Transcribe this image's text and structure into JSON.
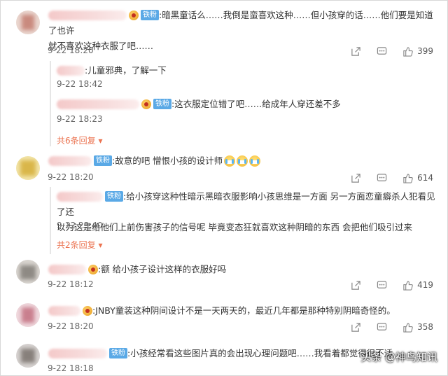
{
  "comments": [
    {
      "badge": "铁粉",
      "text": ":暗黑童话么……我倒是蛮喜欢这种……但小孩穿的话……他们要是知道了也许",
      "text2": "就不喜欢这种衣服了吧……",
      "time": "9-22 18:20",
      "likes": "399",
      "replies": [
        {
          "text": ":儿童邪典，了解一下",
          "time": "9-22 18:42"
        },
        {
          "badge": "铁粉",
          "text": ":这衣服定位错了吧……给成年人穿还差不多",
          "time": "9-22 18:23"
        }
      ],
      "more": "共6条回复 ▾"
    },
    {
      "badge": "铁粉",
      "text": ":故意的吧 憎恨小孩的设计师",
      "time": "9-22 18:20",
      "likes": "614",
      "replies": [
        {
          "badge": "铁粉",
          "text": ":给小孩穿这种性暗示黑暗衣服影响小孩思维是一方面 另一方面恋童癖杀人犯看见了还",
          "text2": "以为这是给他们上前伤害孩子的信号呢 毕竟变态狂就喜欢这种阴暗的东西 会把他们吸引过来",
          "time": "9-22 23:40"
        }
      ],
      "more": "共2条回复 ▾"
    },
    {
      "text": ":额 给小孩子设计这样的衣服好吗",
      "time": "9-22 18:12",
      "likes": "419"
    },
    {
      "text": ":JNBY童装这种阴间设计不是一天两天的，最近几年都是那种特别阴暗奇怪的。",
      "time": "9-22 18:20",
      "likes": "358"
    },
    {
      "badge": "铁粉",
      "text": ":小孩经常看这些图片真的会出现心理问题吧……我看着都觉得很不适",
      "time": "9-22 18:18",
      "likes": ""
    }
  ],
  "watermark": "头条 @神鸟知讯",
  "colors": {
    "more_link": "#eb7350",
    "badge": "#5aa9e6"
  },
  "icons": [
    "share-icon",
    "comment-icon",
    "like-icon"
  ]
}
